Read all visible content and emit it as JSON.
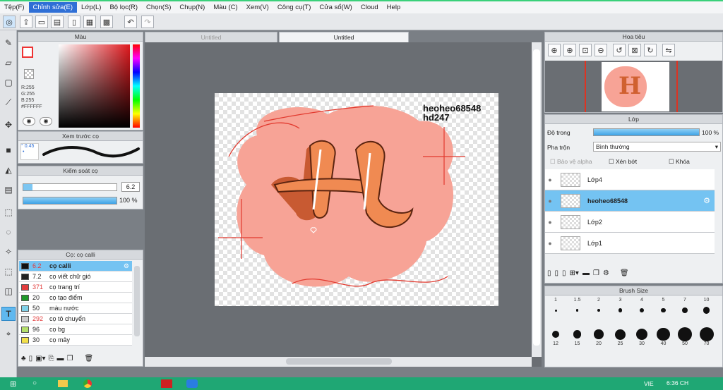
{
  "menu": [
    "Tệp(F)",
    "Chỉnh sửa(E)",
    "Lớp(L)",
    "Bộ lọc(R)",
    "Chọn(S)",
    "Chụp(N)",
    "Màu (C)",
    "Xem(V)",
    "Công cụ(T)",
    "Cửa sổ(W)",
    "Cloud",
    "Help"
  ],
  "tabs": {
    "inactive": "Untitled",
    "active": "Untitled"
  },
  "color_panel": {
    "title": "Màu",
    "r": "R:255",
    "g": "G:255",
    "b": "B:255",
    "hex": "#FFFFFF"
  },
  "preview_panel": {
    "title": "Xem trước cọ",
    "size": "0.45"
  },
  "control_panel": {
    "title": "Kiểm soát cọ",
    "size": "6.2",
    "opacity": "100 %",
    "opacity_level": 1.0
  },
  "brush_panel": {
    "title": "Cọ: cọ calli",
    "items": [
      {
        "size": "6.2",
        "name": "cọ calli",
        "color": "#111111",
        "red": true,
        "selected": true
      },
      {
        "size": "7.2",
        "name": "cọ viết chữ gió",
        "color": "#222222",
        "red": false
      },
      {
        "size": "371",
        "name": "cọ trang trí",
        "color": "#e23d3d",
        "red": true
      },
      {
        "size": "20",
        "name": "cọ tạo điểm",
        "color": "#1f9a2a",
        "red": false
      },
      {
        "size": "50",
        "name": "màu nước",
        "color": "#7fd1e8",
        "red": false
      },
      {
        "size": "292",
        "name": "cọ tô chuyển",
        "color": "#cccccc",
        "red": true
      },
      {
        "size": "96",
        "name": "cọ bg",
        "color": "#b5e06b",
        "red": false
      },
      {
        "size": "30",
        "name": "cọ mây",
        "color": "#f2e04a",
        "red": false
      }
    ]
  },
  "artwork": {
    "watermark": "heoheo68548\nhd247"
  },
  "navigator": {
    "title": "Hoa tiêu"
  },
  "layer_panel": {
    "title": "Lớp",
    "opacity_label": "Độ trong",
    "opacity_value": "100 %",
    "opacity_level": 1.0,
    "blend_label": "Pha trộn",
    "blend_value": "Bình thường",
    "protect_alpha": "Bảo vệ alpha",
    "clip": "Xén bớt",
    "lock": "Khóa",
    "layers": [
      {
        "name": "Lớp4",
        "selected": false
      },
      {
        "name": "heoheo68548",
        "selected": true
      },
      {
        "name": "Lớp2",
        "selected": false
      },
      {
        "name": "Lớp1",
        "selected": false
      }
    ]
  },
  "brush_size_panel": {
    "title": "Brush Size",
    "sizes": [
      "1",
      "1.5",
      "2",
      "3",
      "4",
      "5",
      "7",
      "10",
      "12",
      "15",
      "20",
      "25",
      "30",
      "40",
      "50",
      "70"
    ]
  },
  "taskbar": {
    "lang": "VIE",
    "time": "6:36 CH"
  }
}
